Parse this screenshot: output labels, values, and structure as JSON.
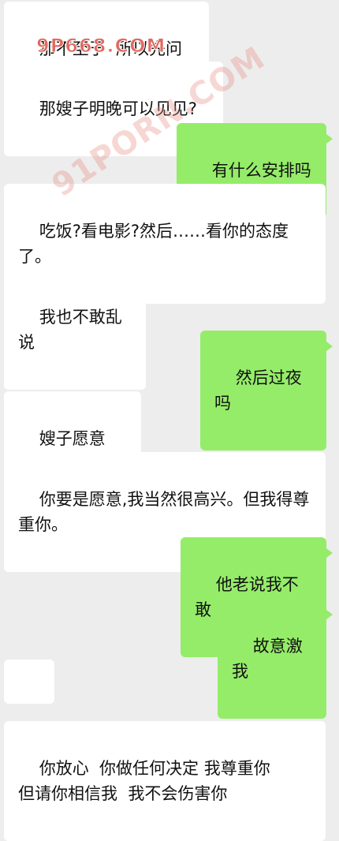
{
  "messages": [
    {
      "side": "in",
      "text": "那不至于  所以先问问"
    },
    {
      "side": "in",
      "text": "那嫂子明晚可以见见?"
    },
    {
      "side": "out",
      "text": "有什么安排吗"
    },
    {
      "side": "in",
      "text": "吃饭?看电影?然后……看你的态度了。"
    },
    {
      "side": "in",
      "text": "我也不敢乱说"
    },
    {
      "side": "out",
      "text": "然后过夜吗"
    },
    {
      "side": "in",
      "text": "嫂子愿意吗?"
    },
    {
      "side": "in",
      "text": "你要是愿意,我当然很高兴。但我得尊重你。"
    },
    {
      "side": "out",
      "text": "他老说我不敢"
    },
    {
      "side": "out",
      "text": "故意激我"
    },
    {
      "side": "in",
      "text": "",
      "icon": "crying-laughing-emoji-icon"
    },
    {
      "side": "in",
      "text": "你放心  你做任何决定 我尊重你\n但请你相信我  我不会伤害你"
    }
  ],
  "watermarks": {
    "site_a": "9P668.COM",
    "site_b": "91PORN.COM"
  }
}
